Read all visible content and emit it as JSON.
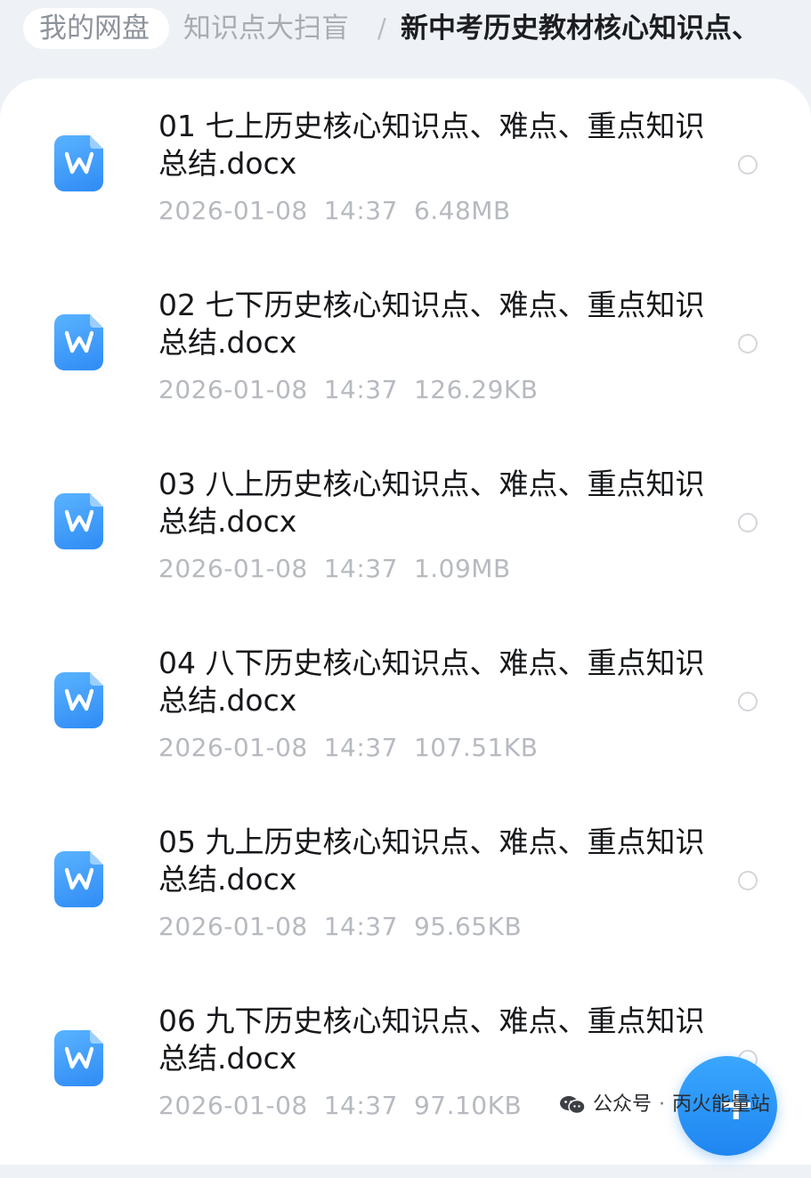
{
  "breadcrumb": {
    "root": "我的网盘",
    "middle": "知识点大扫盲",
    "separator": "/",
    "current": "新中考历史教材核心知识点、"
  },
  "files": [
    {
      "name": "01 七上历史核心知识点、难点、重点知识总结.docx",
      "date": "2026-01-08",
      "time": "14:37",
      "size": "6.48MB",
      "icon": "word-doc-icon"
    },
    {
      "name": "02 七下历史核心知识点、难点、重点知识总结.docx",
      "date": "2026-01-08",
      "time": "14:37",
      "size": "126.29KB",
      "icon": "word-doc-icon"
    },
    {
      "name": "03 八上历史核心知识点、难点、重点知识总结.docx",
      "date": "2026-01-08",
      "time": "14:37",
      "size": "1.09MB",
      "icon": "word-doc-icon"
    },
    {
      "name": "04 八下历史核心知识点、难点、重点知识总结.docx",
      "date": "2026-01-08",
      "time": "14:37",
      "size": "107.51KB",
      "icon": "word-doc-icon"
    },
    {
      "name": "05 九上历史核心知识点、难点、重点知识总结.docx",
      "date": "2026-01-08",
      "time": "14:37",
      "size": "95.65KB",
      "icon": "word-doc-icon"
    },
    {
      "name": "06 九下历史核心知识点、难点、重点知识总结.docx",
      "date": "2026-01-08",
      "time": "14:37",
      "size": "97.10KB",
      "icon": "word-doc-icon"
    }
  ],
  "fab": {
    "label": "+",
    "icon": "plus-icon"
  },
  "watermark": {
    "icon": "wechat-icon",
    "label": "公众号",
    "dot": "·",
    "account": "丙火能量站"
  },
  "colors": {
    "background": "#eef2f7",
    "accent": "#2f8bf5",
    "text": "#15171a",
    "meta": "#b6bac0"
  }
}
